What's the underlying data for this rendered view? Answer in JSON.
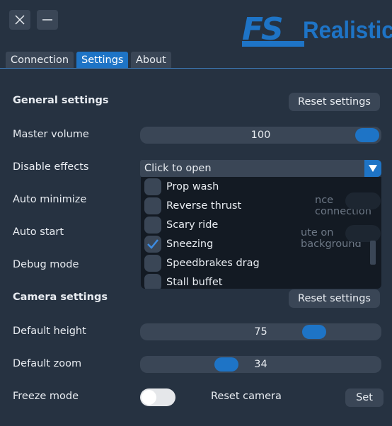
{
  "window": {
    "close_icon": "close-icon",
    "minimize_icon": "minimize-icon"
  },
  "logo": {
    "fs": "FS",
    "realistic": "Realistic"
  },
  "tabs": [
    {
      "label": "Connection",
      "active": false
    },
    {
      "label": "Settings",
      "active": true
    },
    {
      "label": "About",
      "active": false
    }
  ],
  "general": {
    "title": "General settings",
    "reset_label": "Reset settings",
    "master_volume": {
      "label": "Master volume",
      "value": "100",
      "fraction": 1.0
    },
    "disable_effects": {
      "label": "Disable effects",
      "placeholder": "Click to open",
      "options": [
        {
          "label": "Prop wash",
          "checked": false
        },
        {
          "label": "Reverse thrust",
          "checked": false
        },
        {
          "label": "Scary ride",
          "checked": false
        },
        {
          "label": "Sneezing",
          "checked": true
        },
        {
          "label": "Speedbrakes drag",
          "checked": false
        },
        {
          "label": "Stall buffet",
          "checked": false
        }
      ]
    },
    "auto_minimize": {
      "label": "Auto minimize",
      "hidden_text": "nce connection"
    },
    "auto_start": {
      "label": "Auto start",
      "hidden_text": "ute on background"
    },
    "debug_mode": {
      "label": "Debug mode"
    }
  },
  "camera": {
    "title": "Camera settings",
    "reset_label": "Reset settings",
    "default_height": {
      "label": "Default height",
      "value": "75",
      "fraction": 0.75
    },
    "default_zoom": {
      "label": "Default zoom",
      "value": "34",
      "fraction": 0.34
    },
    "freeze_mode": {
      "label": "Freeze mode",
      "on": false
    },
    "reset_camera": {
      "label": "Reset camera",
      "button": "Set"
    }
  },
  "colors": {
    "accent": "#1e74c6",
    "background": "#263241",
    "control": "#3a4656",
    "dropdown_bg": "#131a23"
  }
}
